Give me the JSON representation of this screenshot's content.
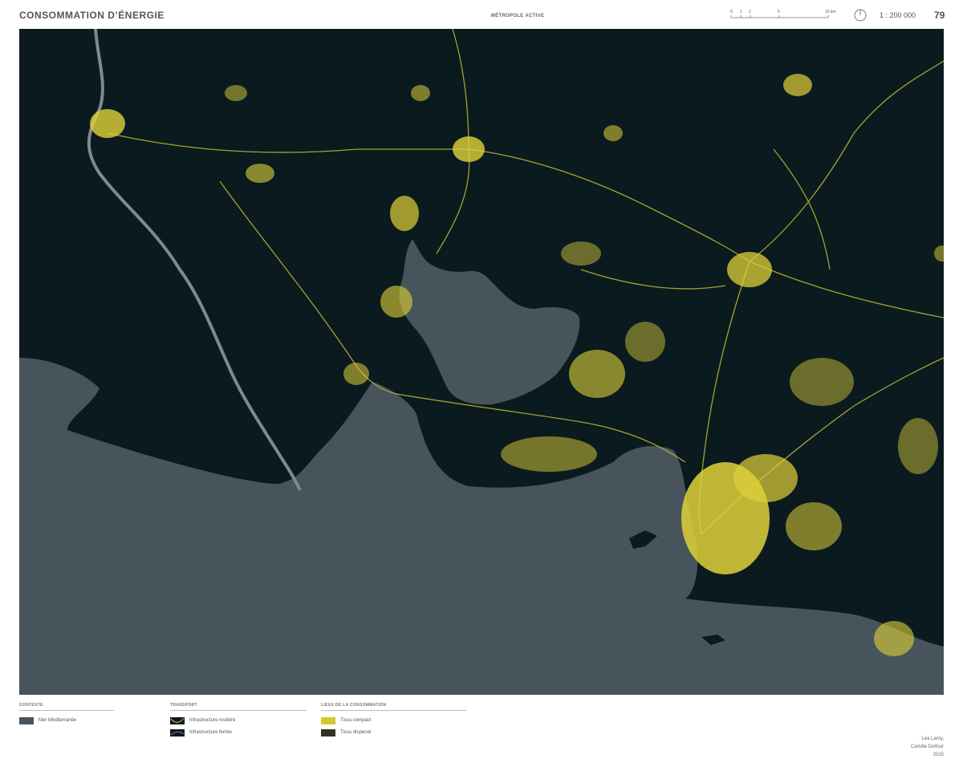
{
  "header": {
    "title": "CONSOMMATION D’ÉNERGIE",
    "subtitle": "MÉTROPOLE ACTIVE",
    "scale_ticks": [
      "0",
      "1",
      "2",
      "5",
      "10 km"
    ],
    "scale": "1 : 200 000",
    "page_number": "79"
  },
  "legend": {
    "contexte": {
      "heading": "CONTEXTE",
      "items": [
        {
          "label": "Mer Méditerranée",
          "color": "#48545b"
        }
      ]
    },
    "transport": {
      "heading": "TRANSPORT",
      "items": [
        {
          "label": "Infrastructure routière",
          "color": "#0d1a20"
        },
        {
          "label": "Infrastructure ferrée",
          "color": "#0d1a20"
        }
      ]
    },
    "consommation": {
      "heading": "LIEUX DE LA CONSOMMATION",
      "items": [
        {
          "label": "Tissu compact",
          "color": "#d6c832"
        },
        {
          "label": "Tissu dispersé",
          "color": "#2f3320"
        }
      ]
    }
  },
  "credits": [
    "Léa Lamy,",
    "Camille Dolfour",
    "2015"
  ],
  "colors": {
    "land": "#0a1a1f",
    "sea": "#48545b",
    "urban": "#e0d239",
    "network": "#b8b035",
    "river": "#7e8a90"
  }
}
